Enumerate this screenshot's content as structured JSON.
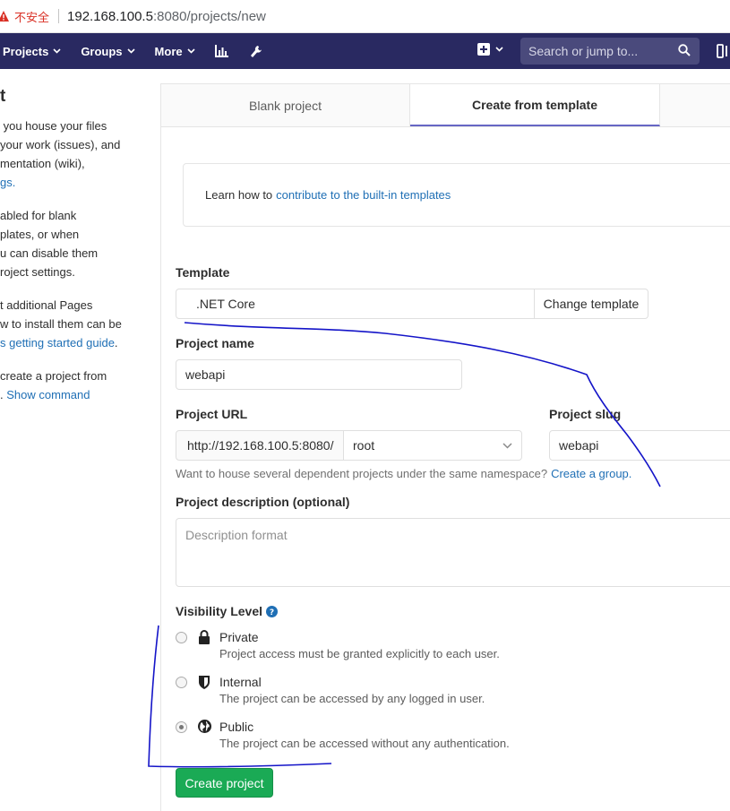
{
  "address_bar": {
    "security_label": "不安全",
    "host": "192.168.100.5",
    "path": ":8080/projects/new"
  },
  "nav": {
    "projects": "Projects",
    "groups": "Groups",
    "more": "More",
    "search_placeholder": "Search or jump to..."
  },
  "sidebar": {
    "heading": "t",
    "para1": [
      " you house your files",
      "your work (issues), and",
      "mentation (wiki),"
    ],
    "para1_link": "gs.",
    "para2": [
      "abled for blank",
      "plates, or when",
      "u can disable them",
      "roject settings."
    ],
    "para3": [
      "t additional Pages",
      "w to install them can be"
    ],
    "para3_link": "s getting started guide",
    "para3_end": ".",
    "para4": "create a project from",
    "para4_prefix": ".",
    "para4_link": "Show command"
  },
  "tabs": {
    "blank": "Blank project",
    "template": "Create from template"
  },
  "info": {
    "text": "Learn how to",
    "link": "contribute to the built-in templates"
  },
  "form": {
    "template_label": "Template",
    "template_value": ".NET Core",
    "change_template": "Change template",
    "name_label": "Project name",
    "name_value": "webapi",
    "url_label": "Project URL",
    "url_prefix": "http://192.168.100.5:8080/",
    "namespace": "root",
    "slug_label": "Project slug",
    "slug_value": "webapi",
    "help_text": "Want to house several dependent projects under the same namespace?",
    "help_link": "Create a group.",
    "desc_label": "Project description (optional)",
    "desc_placeholder": "Description format",
    "visibility_label": "Visibility Level",
    "visibility": [
      {
        "title": "Private",
        "desc": "Project access must be granted explicitly to each user.",
        "selected": false
      },
      {
        "title": "Internal",
        "desc": "The project can be accessed by any logged in user.",
        "selected": false
      },
      {
        "title": "Public",
        "desc": "The project can be accessed without any authentication.",
        "selected": true
      }
    ],
    "submit": "Create project"
  },
  "colors": {
    "nav_bg": "#292961",
    "link": "#1f6fb5",
    "primary_button": "#1aaa55",
    "scribble": "#1414c8"
  }
}
